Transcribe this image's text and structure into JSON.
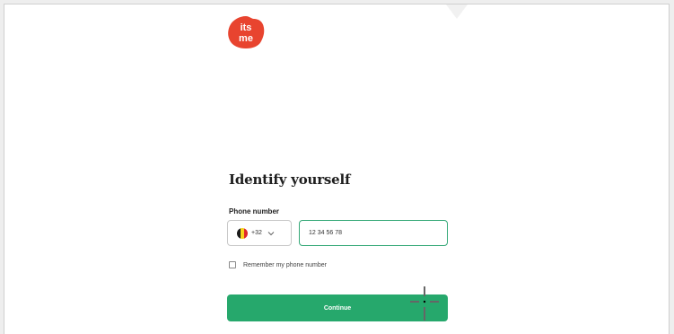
{
  "logo": {
    "text_line1": "its",
    "text_line2": "me",
    "color": "#e8442f"
  },
  "form": {
    "heading": "Identify yourself",
    "phone_label": "Phone number",
    "country_code": "+32",
    "country_flag": "belgium-flag-icon",
    "phone_value": "12 34 56 78",
    "remember_label": "Remember my phone number",
    "remember_checked": false,
    "continue_label": "Continue"
  },
  "colors": {
    "accent": "#26a86c",
    "input_focus_border": "#34a877",
    "flag_black": "#1b1b1b",
    "flag_yellow": "#f7d21c",
    "flag_red": "#e0262b"
  }
}
